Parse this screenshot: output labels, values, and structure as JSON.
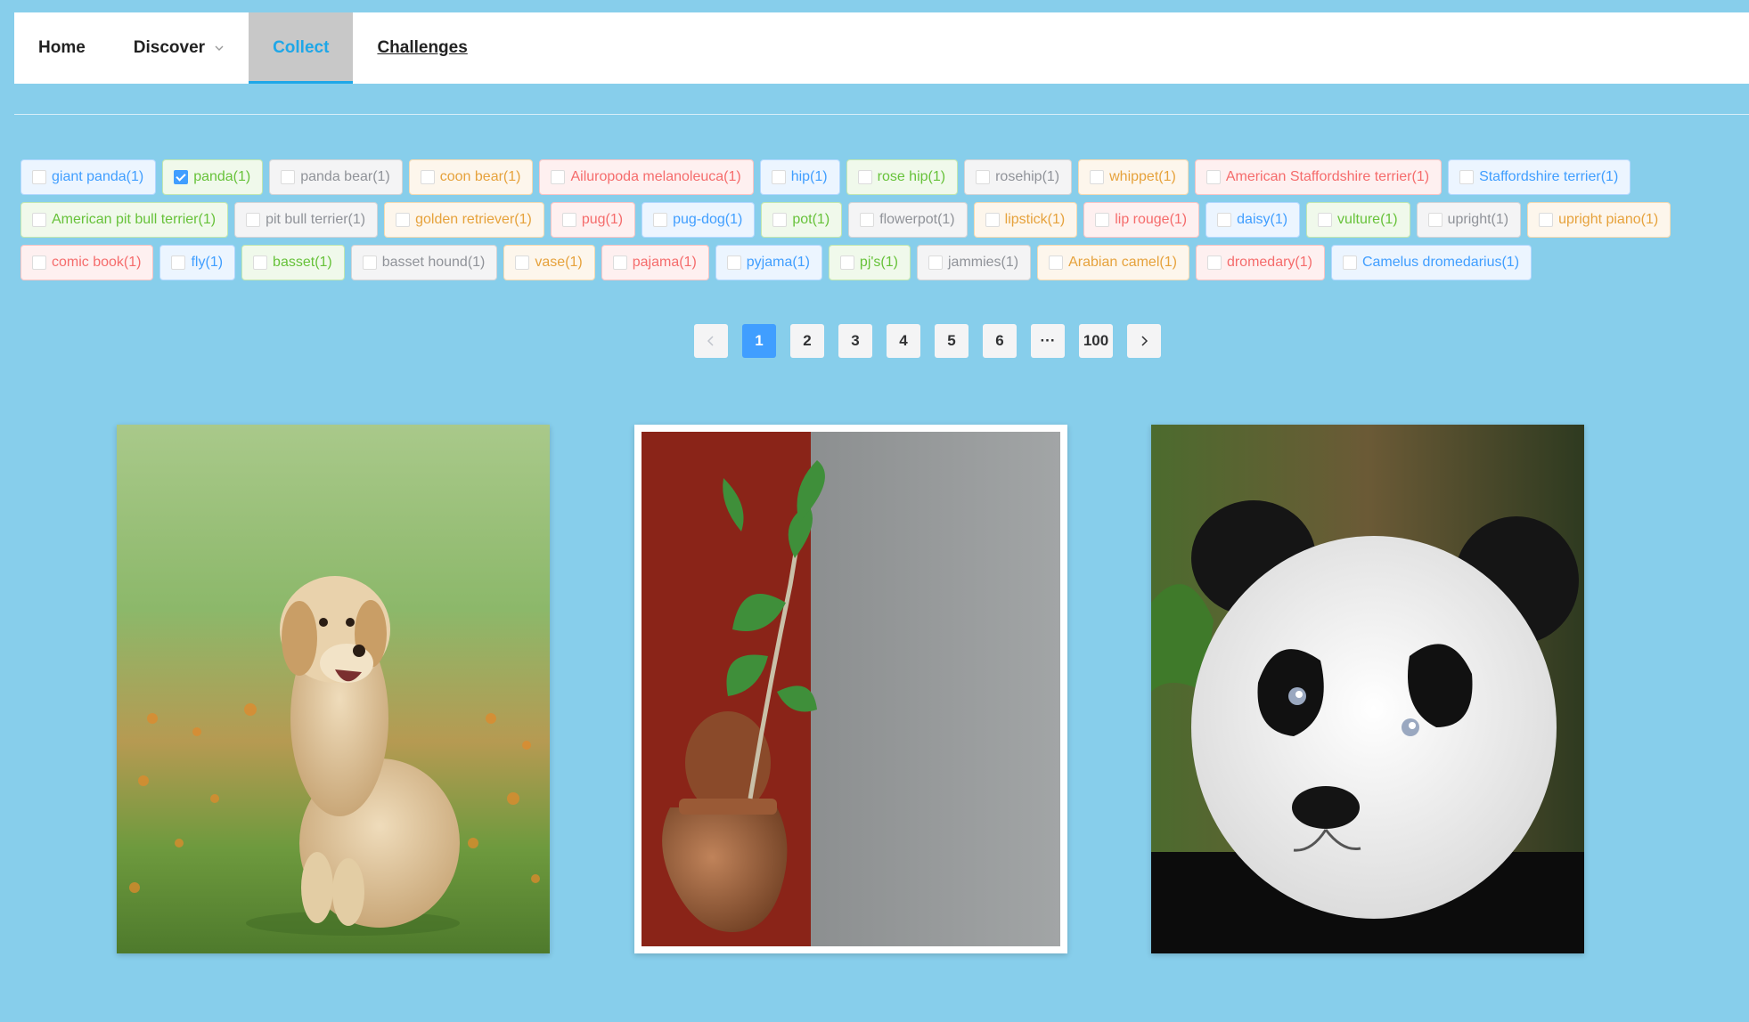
{
  "nav": {
    "items": [
      {
        "label": "Home"
      },
      {
        "label": "Discover"
      },
      {
        "label": "Collect"
      },
      {
        "label": "Challenges"
      }
    ]
  },
  "tags": [
    {
      "label": "giant panda(1)",
      "color": "blue",
      "checked": false
    },
    {
      "label": "panda(1)",
      "color": "green",
      "checked": true
    },
    {
      "label": "panda bear(1)",
      "color": "gray",
      "checked": false
    },
    {
      "label": "coon bear(1)",
      "color": "orange",
      "checked": false
    },
    {
      "label": "Ailuropoda melanoleuca(1)",
      "color": "red",
      "checked": false
    },
    {
      "label": "hip(1)",
      "color": "blue",
      "checked": false
    },
    {
      "label": "rose hip(1)",
      "color": "green",
      "checked": false
    },
    {
      "label": "rosehip(1)",
      "color": "gray",
      "checked": false
    },
    {
      "label": "whippet(1)",
      "color": "orange",
      "checked": false
    },
    {
      "label": "American Staffordshire terrier(1)",
      "color": "red",
      "checked": false
    },
    {
      "label": "Staffordshire terrier(1)",
      "color": "blue",
      "checked": false
    },
    {
      "label": "American pit bull terrier(1)",
      "color": "green",
      "checked": false
    },
    {
      "label": "pit bull terrier(1)",
      "color": "gray",
      "checked": false
    },
    {
      "label": "golden retriever(1)",
      "color": "orange",
      "checked": false
    },
    {
      "label": "pug(1)",
      "color": "red",
      "checked": false
    },
    {
      "label": "pug-dog(1)",
      "color": "blue",
      "checked": false
    },
    {
      "label": "pot(1)",
      "color": "green",
      "checked": false
    },
    {
      "label": "flowerpot(1)",
      "color": "gray",
      "checked": false
    },
    {
      "label": "lipstick(1)",
      "color": "orange",
      "checked": false
    },
    {
      "label": "lip rouge(1)",
      "color": "red",
      "checked": false
    },
    {
      "label": "daisy(1)",
      "color": "blue",
      "checked": false
    },
    {
      "label": "vulture(1)",
      "color": "green",
      "checked": false
    },
    {
      "label": "upright(1)",
      "color": "gray",
      "checked": false
    },
    {
      "label": "upright piano(1)",
      "color": "orange",
      "checked": false
    },
    {
      "label": "comic book(1)",
      "color": "red",
      "checked": false
    },
    {
      "label": "fly(1)",
      "color": "blue",
      "checked": false
    },
    {
      "label": "basset(1)",
      "color": "green",
      "checked": false
    },
    {
      "label": "basset hound(1)",
      "color": "gray",
      "checked": false
    },
    {
      "label": "vase(1)",
      "color": "orange",
      "checked": false
    },
    {
      "label": "pajama(1)",
      "color": "red",
      "checked": false
    },
    {
      "label": "pyjama(1)",
      "color": "blue",
      "checked": false
    },
    {
      "label": "pj's(1)",
      "color": "green",
      "checked": false
    },
    {
      "label": "jammies(1)",
      "color": "gray",
      "checked": false
    },
    {
      "label": "Arabian camel(1)",
      "color": "orange",
      "checked": false
    },
    {
      "label": "dromedary(1)",
      "color": "red",
      "checked": false
    },
    {
      "label": "Camelus dromedarius(1)",
      "color": "blue",
      "checked": false
    }
  ],
  "pagination": {
    "current": "1",
    "pages": [
      "1",
      "2",
      "3",
      "4",
      "5",
      "6",
      "···",
      "100"
    ]
  },
  "colors": {
    "background": "#87ceeb",
    "accent": "#409eff",
    "nav_active": "#1ea7e8"
  }
}
